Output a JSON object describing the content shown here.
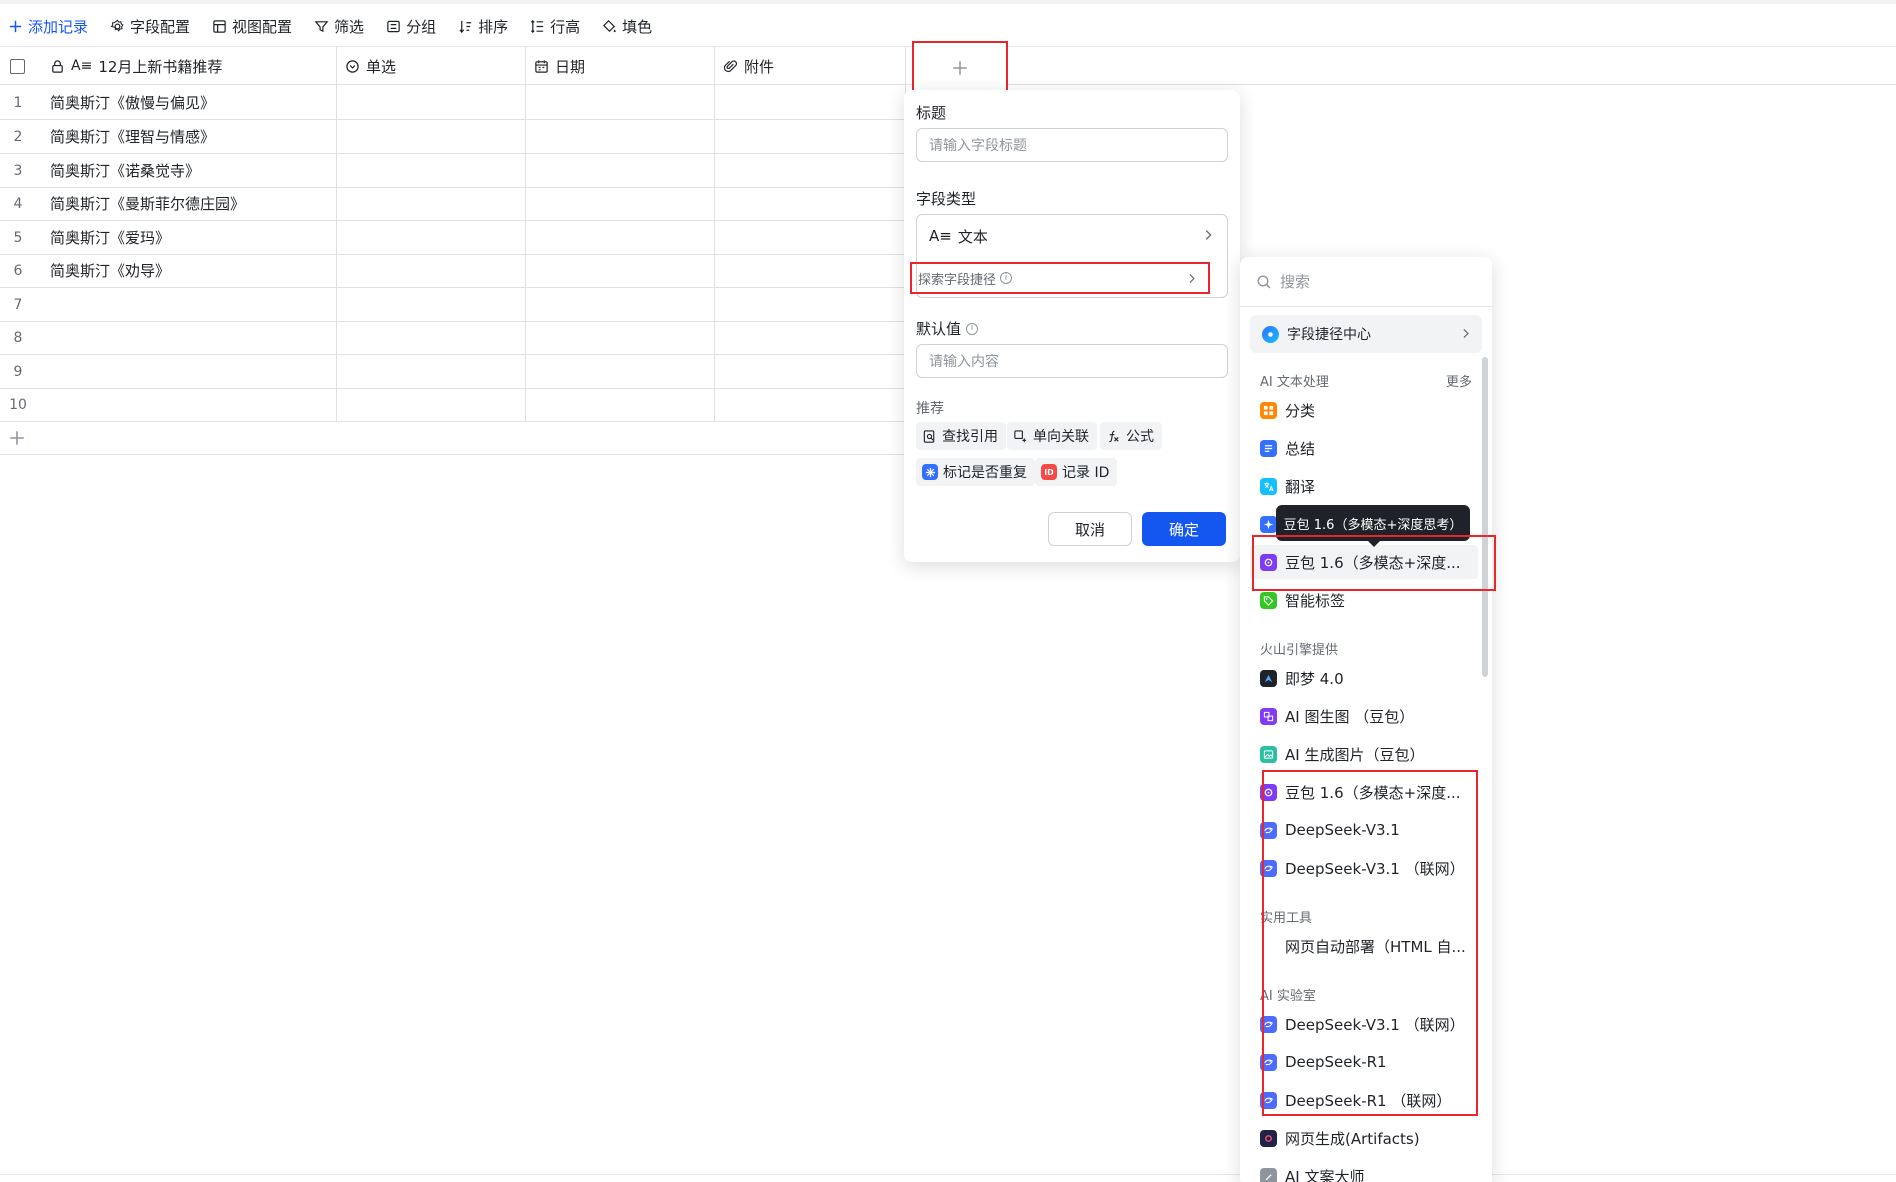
{
  "toolbar": {
    "add_record": "添加记录",
    "field_config": "字段配置",
    "view_config": "视图配置",
    "filter": "筛选",
    "group": "分组",
    "sort": "排序",
    "row_height": "行高",
    "fill_color": "填色"
  },
  "grid": {
    "columns": [
      "12月上新书籍推荐",
      "单选",
      "日期",
      "附件"
    ],
    "row_numbers": [
      "1",
      "2",
      "3",
      "4",
      "5",
      "6",
      "7",
      "8",
      "9",
      "10"
    ],
    "titles": [
      "简奥斯汀《傲慢与偏见》",
      "简奥斯汀《理智与情感》",
      "简奥斯汀《诺桑觉寺》",
      "简奥斯汀《曼斯菲尔德庄园》",
      "简奥斯汀《爱玛》",
      "简奥斯汀《劝导》",
      "",
      "",
      "",
      ""
    ]
  },
  "field_panel": {
    "title_label": "标题",
    "title_placeholder": "请输入字段标题",
    "type_label": "字段类型",
    "type_value": "文本",
    "type_icon_text": "A≡",
    "explore_label": "探索字段捷径",
    "default_label": "默认值",
    "default_placeholder": "请输入内容",
    "recommend_label": "推荐",
    "recommend_items": [
      "查找引用",
      "单向关联",
      "公式",
      "标记是否重复",
      "记录 ID"
    ],
    "cancel": "取消",
    "confirm": "确定"
  },
  "dropdown": {
    "search_placeholder": "搜索",
    "center_label": "字段捷径中心",
    "section_ai_text": "AI 文本处理",
    "more": "更多",
    "ai_text_items": [
      "分类",
      "总结",
      "翻译",
      "",
      "豆包 1.6（多模态+深度...",
      "智能标签"
    ],
    "section_volc": "火山引擎提供",
    "volc_items": [
      "即梦 4.0",
      "AI 图生图 （豆包）",
      "AI 生成图片（豆包）",
      "豆包 1.6（多模态+深度...",
      "DeepSeek-V3.1",
      "DeepSeek-V3.1 （联网）"
    ],
    "section_tools": "实用工具",
    "tools_items": [
      "网页自动部署（HTML 自..."
    ],
    "section_lab": "AI 实验室",
    "lab_items": [
      "DeepSeek-V3.1 （联网）",
      "DeepSeek-R1",
      "DeepSeek-R1 （联网）",
      "网页生成(Artifacts)",
      "AI 文案大师"
    ]
  },
  "tooltip": "豆包 1.6（多模态+深度思考）",
  "colors": {
    "primary": "#1456f0",
    "highlight_red": "#e8262c",
    "orange": "#ff8800",
    "blue": "#3370ff",
    "cyan": "#14c0ff",
    "purple": "#7f3bf5",
    "green": "#34c724"
  }
}
